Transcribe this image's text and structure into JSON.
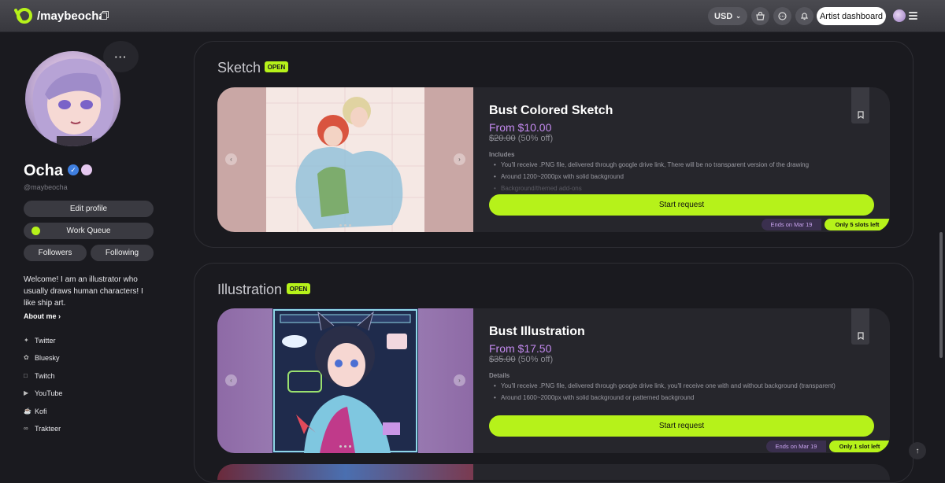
{
  "header": {
    "handle": "/maybeocha",
    "currency": "USD",
    "artist_dashboard": "Artist dashboard",
    "icons": [
      "copy-icon",
      "cart-icon",
      "chat-icon",
      "bell-icon",
      "menu-icon"
    ]
  },
  "profile": {
    "more": "···",
    "name": "Ocha",
    "handle": "@maybeocha",
    "edit_profile": "Edit profile",
    "work_queue": "Work Queue",
    "followers": "Followers",
    "following": "Following",
    "bio": "Welcome! I am an illustrator who usually draws human characters! I like ship art.",
    "about_me": "About me",
    "socials": [
      {
        "label": "Twitter",
        "icon": "twitter-icon"
      },
      {
        "label": "Bluesky",
        "icon": "bluesky-icon"
      },
      {
        "label": "Twitch",
        "icon": "twitch-icon"
      },
      {
        "label": "YouTube",
        "icon": "youtube-icon"
      },
      {
        "label": "Kofi",
        "icon": "kofi-icon"
      },
      {
        "label": "Trakteer",
        "icon": "link-icon"
      }
    ]
  },
  "sections": [
    {
      "title": "Sketch",
      "status": "OPEN",
      "card": {
        "title": "Bust Colored Sketch",
        "price": "From $10.00",
        "old_price": "$20.00",
        "discount": "(50% off)",
        "list_heading": "Includes",
        "items": [
          "You'll receive .PNG file, delivered through google drive link, There will be no transparent version of the drawing",
          "Around 1200~2000px with solid background",
          "Background/themed add-ons"
        ],
        "cta": "Start request",
        "ends": "Ends on Mar 19",
        "slots": "Only 5 slots left"
      }
    },
    {
      "title": "Illustration",
      "status": "OPEN",
      "card": {
        "title": "Bust Illustration",
        "price": "From $17.50",
        "old_price": "$35.00",
        "discount": "(50% off)",
        "list_heading": "Details",
        "items": [
          "You'll receive .PNG file, delivered through google drive link, you'll receive one with and without background (transparent)",
          "Around 1600~2000px with solid background or patterned background"
        ],
        "cta": "Start request",
        "ends": "Ends on Mar 19",
        "slots": "Only 1 slot left"
      }
    }
  ],
  "colors": {
    "accent": "#b6f21a",
    "price": "#c48af0",
    "background": "#1a1a1f",
    "card": "#26262c"
  }
}
